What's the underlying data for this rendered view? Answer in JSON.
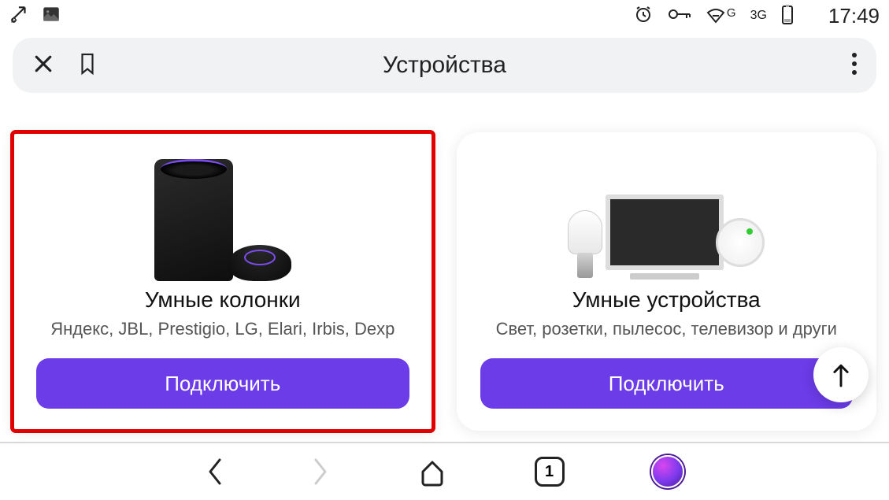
{
  "status": {
    "network_label_1": "G",
    "network_label_2": "3G",
    "time": "17:49"
  },
  "browser": {
    "title": "Устройства"
  },
  "cards": [
    {
      "title": "Умные колонки",
      "subtitle": "Яндекс, JBL, Prestigio, LG, Elari, Irbis, Dexp",
      "button": "Подключить",
      "highlighted": true
    },
    {
      "title": "Умные устройства",
      "subtitle": "Свет, розетки, пылесос, телевизор и други",
      "button": "Подключить",
      "highlighted": false
    }
  ],
  "nav": {
    "tab_count": "1"
  }
}
